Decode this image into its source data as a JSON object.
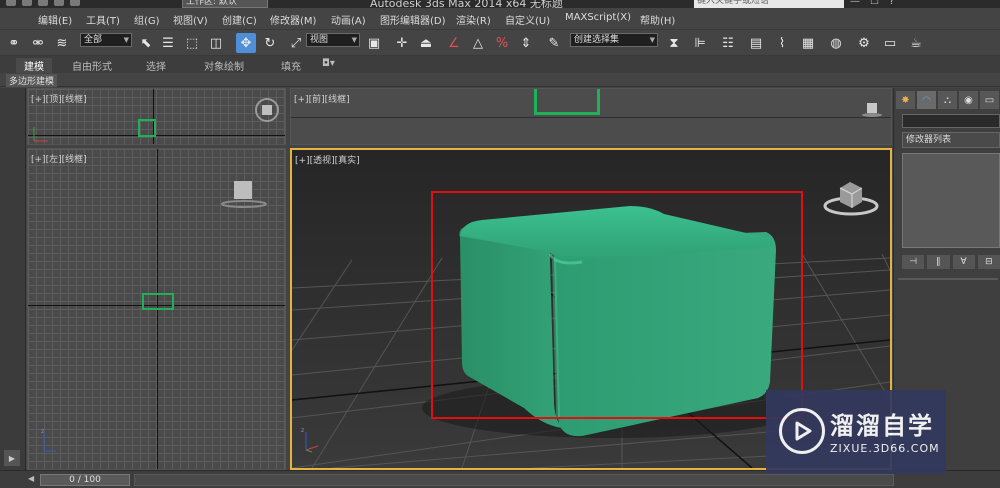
{
  "titlebar": {
    "workspace": "工作区: 默认",
    "title": "Autodesk 3ds Max  2014 x64      无标题",
    "search_placeholder": "键入关键字或短语",
    "window_controls": [
      "—",
      "☐",
      "?"
    ]
  },
  "menu": {
    "items": [
      "编辑(E)",
      "工具(T)",
      "组(G)",
      "视图(V)",
      "创建(C)",
      "修改器(M)",
      "动画(A)",
      "图形编辑器(D)",
      "渲染(R)",
      "自定义(U)",
      "MAXScript(X)",
      "帮助(H)"
    ]
  },
  "toolbar": {
    "selection_filter": "全部",
    "reference_coord": "视图",
    "named_selection": "创建选择集",
    "icons": [
      "link-icon",
      "unlink-icon",
      "bind-spacewarp-icon",
      "select-object-icon",
      "select-by-name-icon",
      "rect-selection-icon",
      "window-crossing-icon",
      "select-move-icon",
      "select-rotate-icon",
      "select-scale-icon",
      "use-pivot-icon",
      "manipulate-icon",
      "snap-toggle-icon",
      "angle-snap-icon",
      "percent-snap-icon",
      "spinner-snap-icon",
      "edit-named-sets-icon",
      "mirror-icon",
      "align-icon",
      "layer-manager-icon",
      "graphite-toggle-icon",
      "curve-editor-icon",
      "schematic-view-icon",
      "material-editor-icon",
      "render-setup-icon",
      "rendered-frame-icon",
      "render-icon"
    ]
  },
  "ribbon": {
    "tabs": [
      "建模",
      "自由形式",
      "选择",
      "对象绘制",
      "填充"
    ],
    "active_tab": "建模",
    "subtitle": "多边形建模"
  },
  "viewports": {
    "top": {
      "label_plus": "[+]",
      "label_view": "[顶]",
      "label_shading": "[线框]"
    },
    "front": {
      "label_plus": "[+]",
      "label_view": "[前]",
      "label_shading": "[线框]"
    },
    "left": {
      "label_plus": "[+]",
      "label_view": "[左]",
      "label_shading": "[线框]"
    },
    "perspective": {
      "label_plus": "[+]",
      "label_view": "[透视]",
      "label_shading": "[真实]"
    }
  },
  "command_panel": {
    "modifier_list": "修改器列表",
    "tabs": [
      "create-tab-icon",
      "modify-tab-icon",
      "hierarchy-tab-icon",
      "motion-tab-icon",
      "display-tab-icon"
    ]
  },
  "timeline": {
    "frame": "0 / 100"
  },
  "watermark": {
    "name": "溜溜自学",
    "url": "ZIXUE.3D66.COM"
  },
  "colors": {
    "box": "#3aa07a",
    "selection_bracket": "#e01010",
    "active_viewport_border": "#e3b540",
    "watermark_bg": "#33395e"
  }
}
